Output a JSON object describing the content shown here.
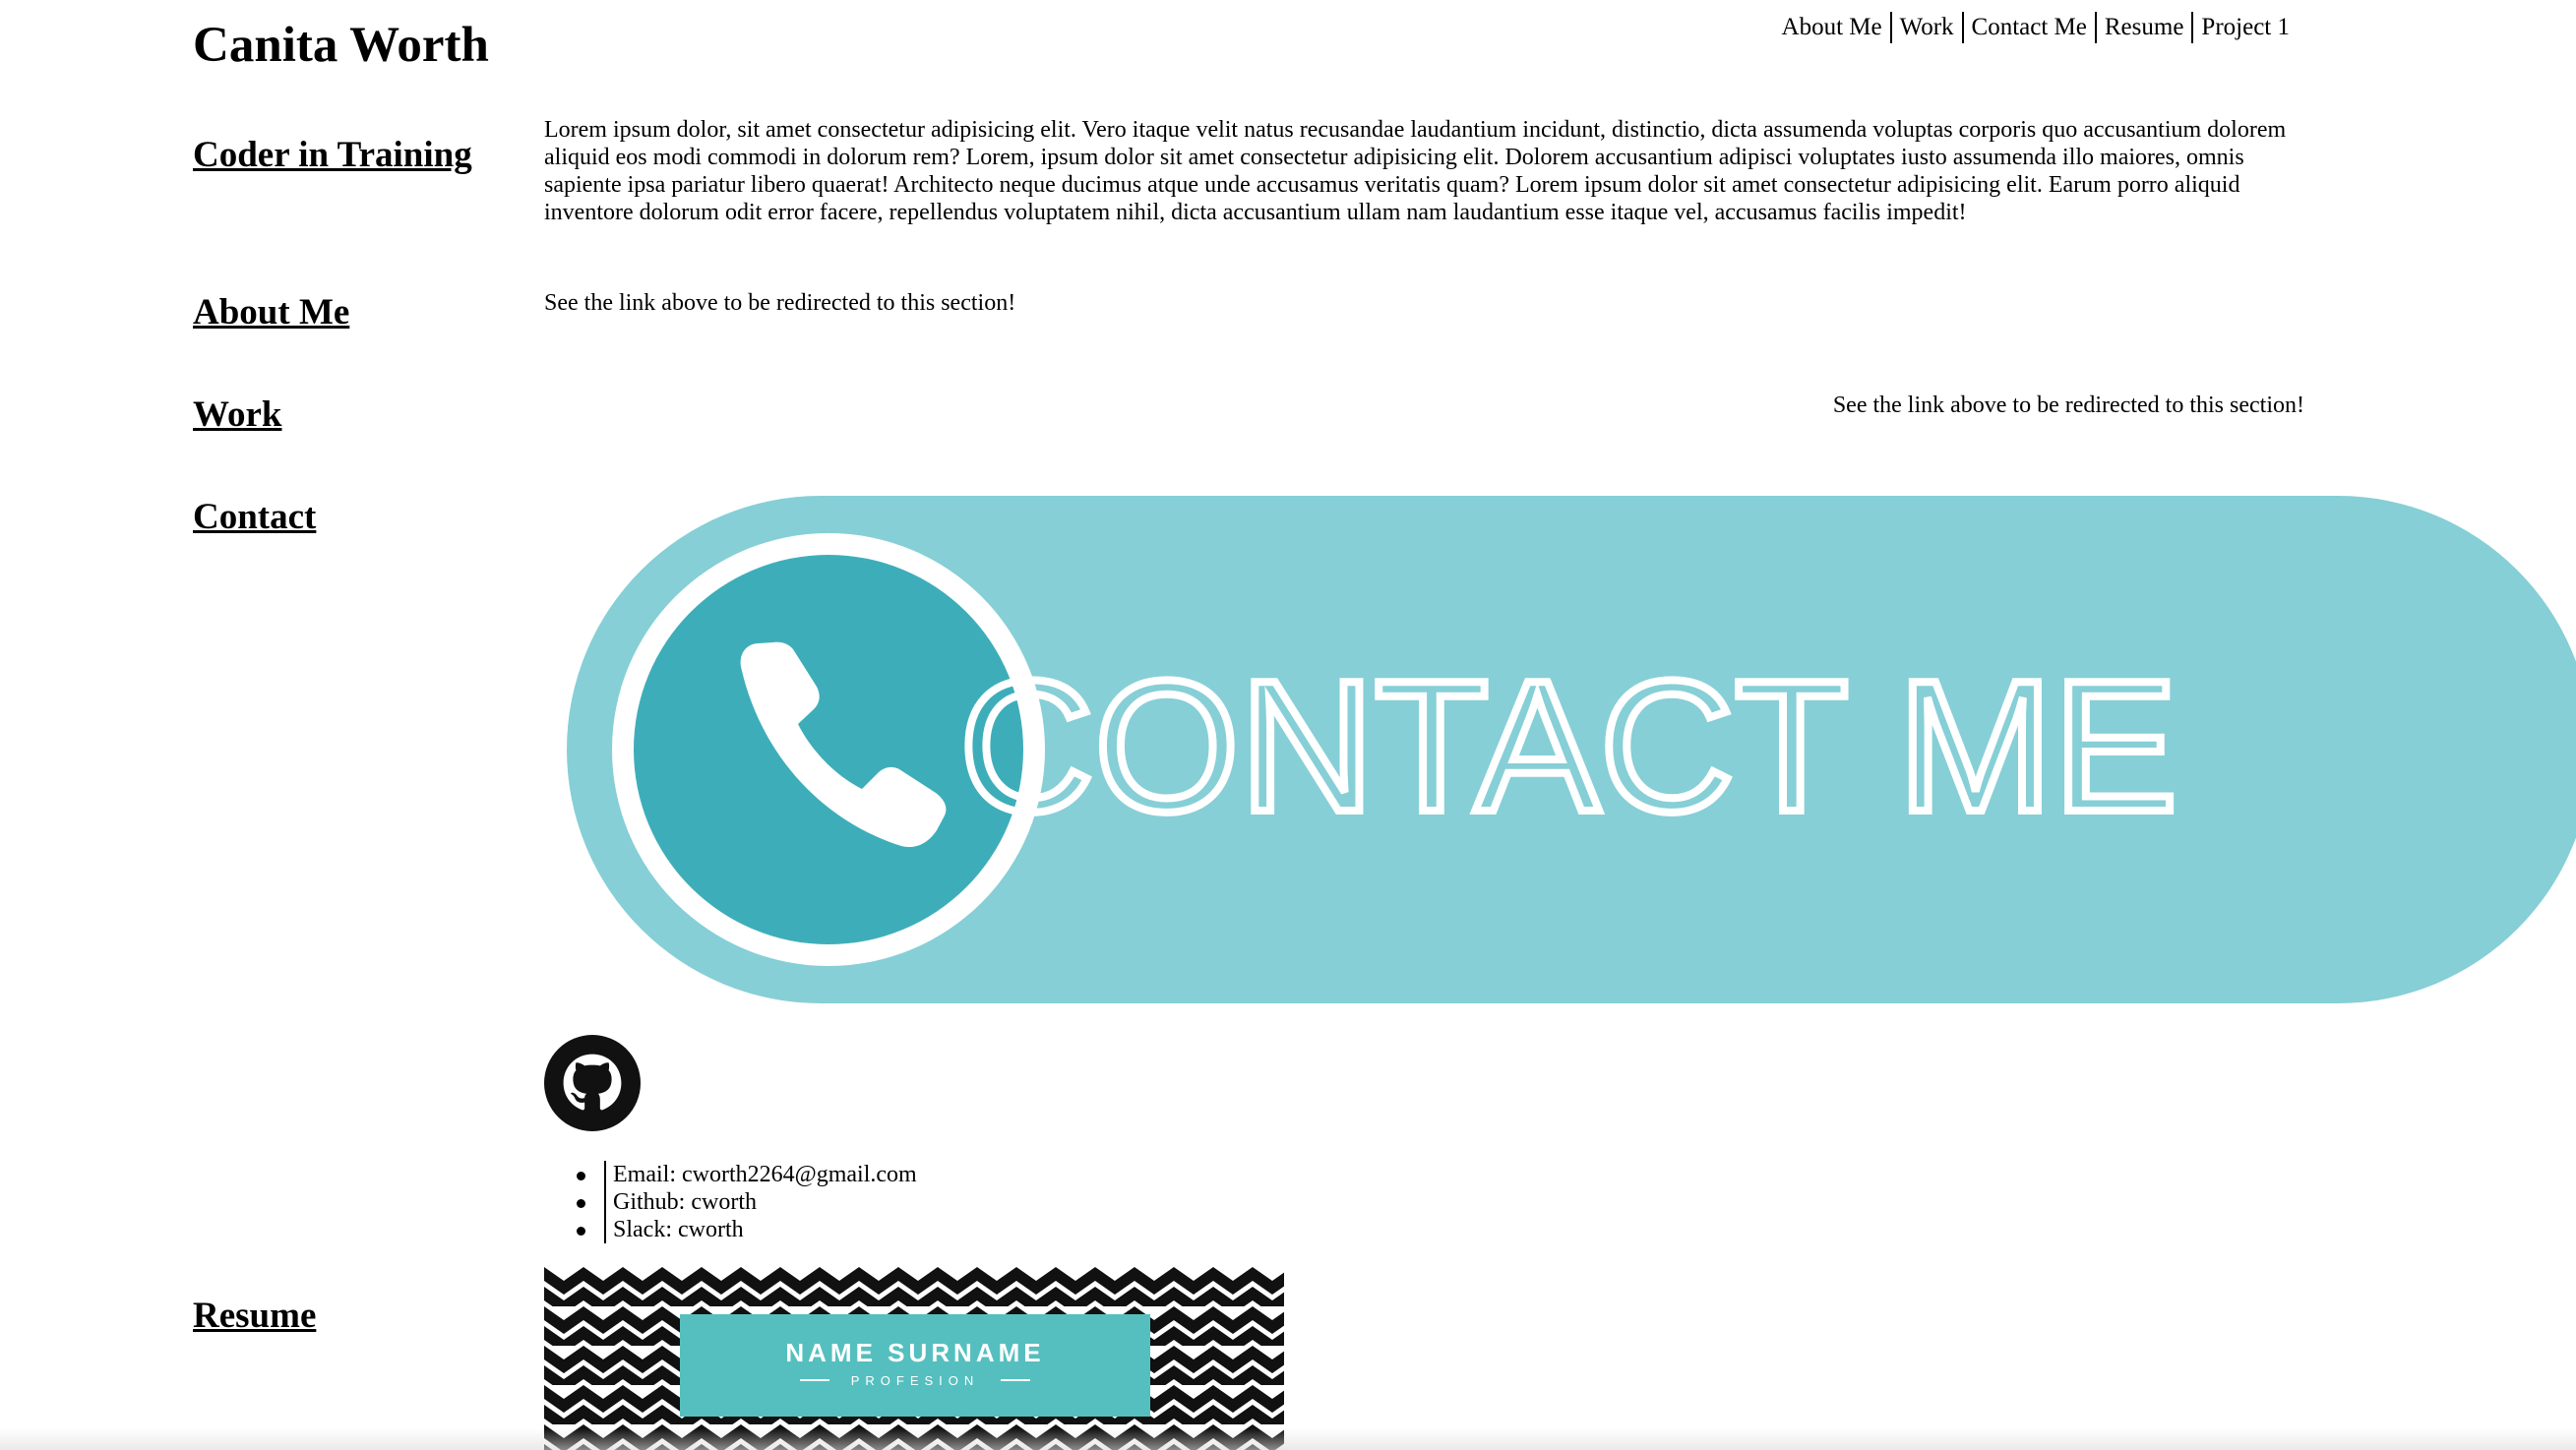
{
  "header": {
    "title": "Canita Worth"
  },
  "nav": {
    "items": [
      {
        "label": "About Me"
      },
      {
        "label": "Work"
      },
      {
        "label": "Contact Me"
      },
      {
        "label": "Resume"
      },
      {
        "label": "Project 1"
      }
    ]
  },
  "sections": {
    "intro": {
      "heading": "Coder in Training",
      "text": "Lorem ipsum dolor, sit amet consectetur adipisicing elit. Vero itaque velit natus recusandae laudantium incidunt, distinctio, dicta assumenda voluptas corporis quo accusantium dolorem aliquid eos modi commodi in dolorum rem? Lorem, ipsum dolor sit amet consectetur adipisicing elit. Dolorem accusantium adipisci voluptates iusto assumenda illo maiores, omnis sapiente ipsa pariatur libero quaerat! Architecto neque ducimus atque unde accusamus veritatis quam? Lorem ipsum dolor sit amet consectetur adipisicing elit. Earum porro aliquid inventore dolorum odit error facere, repellendus voluptatem nihil, dicta accusantium ullam nam laudantium esse itaque vel, accusamus facilis impedit!"
    },
    "about": {
      "heading": "About Me",
      "text": "See the link above to be redirected to this section!"
    },
    "work": {
      "heading": "Work",
      "text": "See the link above to be redirected to this section!"
    },
    "contact": {
      "heading": "Contact",
      "banner_text": "CONTACT ME",
      "list": [
        {
          "text": "Email: cworth2264@gmail.com"
        },
        {
          "text": "Github: cworth"
        },
        {
          "text": "Slack: cworth"
        }
      ]
    },
    "resume": {
      "heading": "Resume",
      "card_name": "NAME SURNAME",
      "card_subtitle": "PROFESION"
    }
  },
  "colors": {
    "banner_bg": "#86CFD6",
    "phone_circle": "#3DAEB9",
    "card_accent": "#55BFBF"
  },
  "icons": {
    "phone": "phone-icon",
    "github": "github-icon"
  }
}
